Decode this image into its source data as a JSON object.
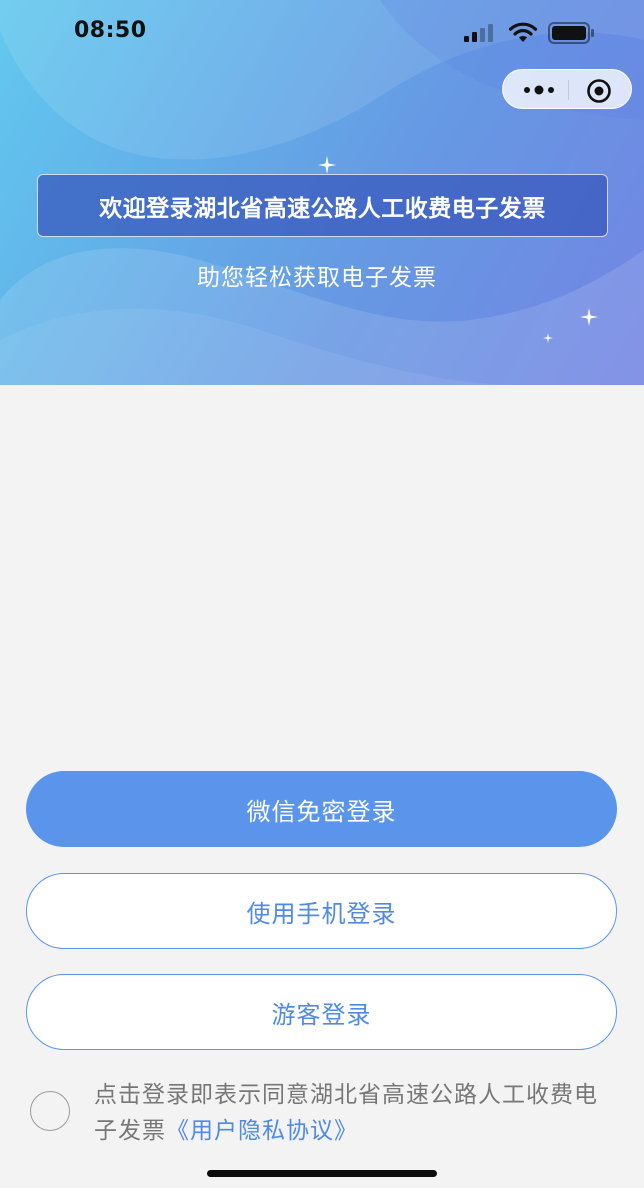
{
  "status_bar": {
    "time": "08:50",
    "icons": [
      "signal-icon",
      "wifi-icon",
      "battery-icon"
    ]
  },
  "capsule": {
    "icons": [
      "more-icon",
      "close-target-icon"
    ]
  },
  "hero": {
    "title": "欢迎登录湖北省高速公路人工收费电子发票",
    "subtitle": "助您轻松获取电子发票",
    "decorations": [
      "sparkle-icon",
      "sparkle-icon",
      "sparkle-icon"
    ]
  },
  "actions": {
    "wechat_login_label": "微信免密登录",
    "phone_login_label": "使用手机登录",
    "guest_login_label": "游客登录"
  },
  "agreement": {
    "checked": false,
    "text_before": "点击登录即表示同意湖北省高速公路人工收费电子发票",
    "link_label": "《用户隐私协议》"
  },
  "colors": {
    "primary": "#5a95eb",
    "link": "#4f8ae4",
    "background": "#f3f3f3",
    "hero_gradient_start": "#63c9ef",
    "hero_gradient_end": "#7384e3"
  }
}
